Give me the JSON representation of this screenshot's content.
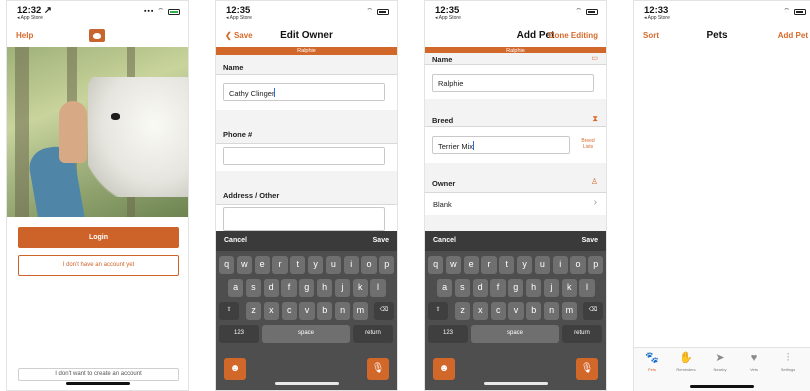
{
  "phone1": {
    "time": "12:32 ↗",
    "back_label": "◂ App Store",
    "nav_left": "Help",
    "login_label": "Login",
    "no_account_label": "I don't have an account yet",
    "no_create_label": "I don't want to create an account"
  },
  "phone2": {
    "time": "12:35",
    "back_label": "◂ App Store",
    "nav_left": "Save",
    "nav_title": "Edit Owner",
    "band_label": "Ralphie",
    "sections": {
      "name": "Name",
      "phone": "Phone #",
      "address": "Address / Other"
    },
    "name_value": "Cathy Clinger",
    "phone_value": "",
    "address_value": "",
    "kb_cancel": "Cancel",
    "kb_save": "Save"
  },
  "phone3": {
    "time": "12:35",
    "back_label": "◂ App Store",
    "nav_title": "Add Pet",
    "nav_right": "Done Editing",
    "band_label": "Ralphie",
    "sections": {
      "name": "Name",
      "breed": "Breed",
      "owner": "Owner"
    },
    "name_value": "Ralphie",
    "breed_value": "Terrier Mix",
    "breed_lists_label": "Breed Lists",
    "owner_value": "Blank",
    "kb_cancel": "Cancel",
    "kb_save": "Save"
  },
  "keyboard": {
    "row1": [
      "q",
      "w",
      "e",
      "r",
      "t",
      "y",
      "u",
      "i",
      "o",
      "p"
    ],
    "row2": [
      "a",
      "s",
      "d",
      "f",
      "g",
      "h",
      "j",
      "k",
      "l"
    ],
    "row3": [
      "z",
      "x",
      "c",
      "v",
      "b",
      "n",
      "m"
    ],
    "shift": "⇧",
    "backspace": "⌫",
    "num_key": "123",
    "space_key": "space",
    "return_key": "return",
    "emoji": "☻",
    "mic": "🎙"
  },
  "phone4": {
    "time": "12:33",
    "back_label": "◂ App Store",
    "nav_left": "Sort",
    "nav_title": "Pets",
    "nav_right": "Add Pet",
    "tabs": [
      {
        "label": "Pets",
        "icon": "paw-icon"
      },
      {
        "label": "Reminders",
        "icon": "hand-icon"
      },
      {
        "label": "Nearby",
        "icon": "compass-icon"
      },
      {
        "label": "Vets",
        "icon": "heart-icon"
      },
      {
        "label": "Settings",
        "icon": "sliders-icon"
      }
    ]
  },
  "colors": {
    "accent": "#d2672a",
    "keyboard_bg": "#4e4e4e",
    "section_bg": "#f3f3f3"
  }
}
